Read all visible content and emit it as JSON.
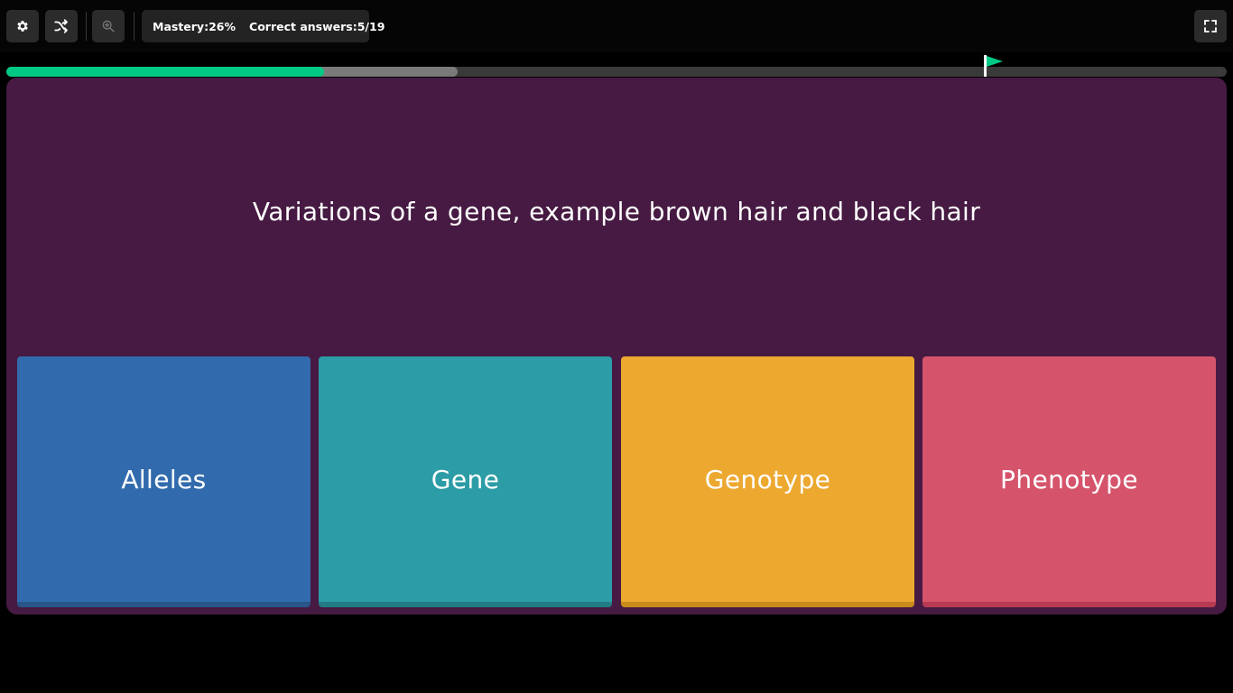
{
  "toolbar": {
    "settings_icon": "gear-icon",
    "power_up_icon": "shuffle-icon",
    "zoom_icon": "zoom-in-icon",
    "fullscreen_icon": "fullscreen-icon"
  },
  "stats": {
    "mastery_label": "Mastery:",
    "mastery_value": "26%",
    "correct_label": "Correct answers:",
    "correct_value": "5/19"
  },
  "progress": {
    "completed_fraction": 0.26,
    "buffer_fraction": 0.37,
    "goal_fraction": 0.8,
    "fill_color": "#00c985",
    "goal_icon": "flag-icon"
  },
  "question": {
    "text": "Variations of a gene, example brown hair and black hair",
    "background_color": "#461a42"
  },
  "options": [
    {
      "label": "Alleles",
      "color": "#326bad",
      "edge_color": "#28558a"
    },
    {
      "label": "Gene",
      "color": "#2c9ca6",
      "edge_color": "#237c85"
    },
    {
      "label": "Genotype",
      "color": "#eca82f",
      "edge_color": "#c98a1c"
    },
    {
      "label": "Phenotype",
      "color": "#d5546c",
      "edge_color": "#b83a52"
    }
  ]
}
